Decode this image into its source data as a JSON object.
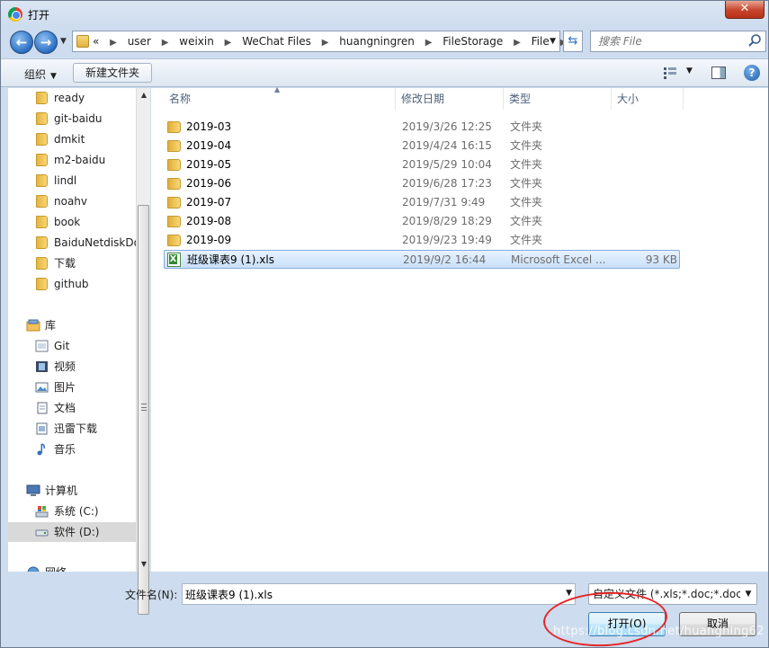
{
  "window": {
    "title": "打开",
    "close_label": "✕"
  },
  "address": {
    "crumbs": [
      "«",
      "user",
      "weixin",
      "WeChat Files",
      "huangningren",
      "FileStorage",
      "File"
    ],
    "search_placeholder": "搜索 File"
  },
  "toolbar": {
    "organize_label": "组织",
    "new_folder_label": "新建文件夹",
    "help_label": "?"
  },
  "sidebar": {
    "folders": [
      "ready",
      "git-baidu",
      "dmkit",
      "m2-baidu",
      "lindl",
      "noahv",
      "book",
      "BaiduNetdiskDownload",
      "下载",
      "github"
    ],
    "library_label": "库",
    "libraries": [
      {
        "label": "Git",
        "icon": "git-library-icon"
      },
      {
        "label": "视频",
        "icon": "video-icon"
      },
      {
        "label": "图片",
        "icon": "picture-icon"
      },
      {
        "label": "文档",
        "icon": "document-icon"
      },
      {
        "label": "迅雷下载",
        "icon": "download-icon"
      },
      {
        "label": "音乐",
        "icon": "music-icon"
      }
    ],
    "computer_label": "计算机",
    "drives": [
      "系统 (C:)",
      "软件 (D:)"
    ],
    "network_label": "网络"
  },
  "columns": {
    "name": "名称",
    "date": "修改日期",
    "type": "类型",
    "size": "大小"
  },
  "files": [
    {
      "name": "2019-03",
      "date": "2019/3/26 12:25",
      "type": "文件夹",
      "size": ""
    },
    {
      "name": "2019-04",
      "date": "2019/4/24 16:15",
      "type": "文件夹",
      "size": ""
    },
    {
      "name": "2019-05",
      "date": "2019/5/29 10:04",
      "type": "文件夹",
      "size": ""
    },
    {
      "name": "2019-06",
      "date": "2019/6/28 17:23",
      "type": "文件夹",
      "size": ""
    },
    {
      "name": "2019-07",
      "date": "2019/7/31 9:49",
      "type": "文件夹",
      "size": ""
    },
    {
      "name": "2019-08",
      "date": "2019/8/29 18:29",
      "type": "文件夹",
      "size": ""
    },
    {
      "name": "2019-09",
      "date": "2019/9/23 19:49",
      "type": "文件夹",
      "size": ""
    },
    {
      "name": "班级课表9 (1).xls",
      "date": "2019/9/2 16:44",
      "type": "Microsoft Excel ...",
      "size": "93 KB"
    }
  ],
  "bottom": {
    "filename_label": "文件名(N):",
    "filename_value": "班级课表9 (1).xls",
    "filter_value": "自定义文件 (*.xls;*.doc;*.docx)",
    "open_label": "打开(O)",
    "cancel_label": "取消"
  },
  "watermark": "https://blog.csdn.net/huangning62"
}
